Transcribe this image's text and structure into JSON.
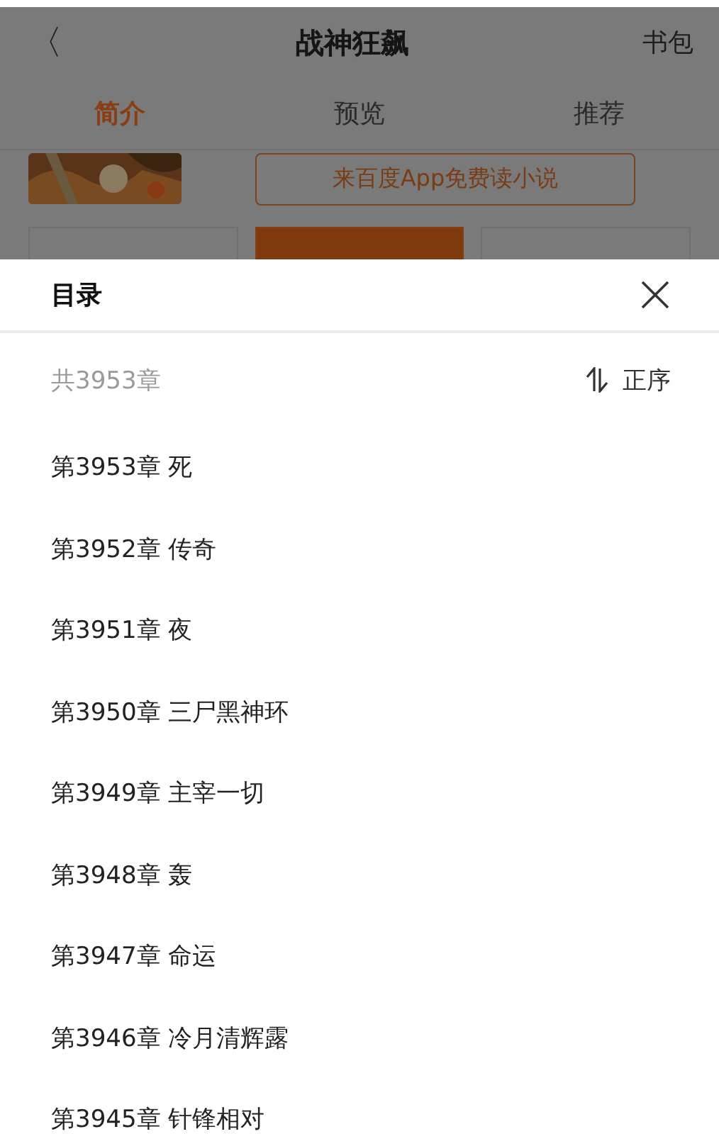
{
  "header": {
    "back": "〈",
    "title": "战神狂飙",
    "action": "书包"
  },
  "tabs": [
    {
      "label": "简介",
      "selected": true
    },
    {
      "label": "预览",
      "selected": false
    },
    {
      "label": "推荐",
      "selected": false
    }
  ],
  "promo": {
    "kind": "picture",
    "tip": "来百度App免费读小说"
  },
  "buttons": [
    {
      "primary": false
    },
    {
      "primary": true
    },
    {
      "primary": false
    }
  ],
  "catalog": {
    "title": "目录",
    "total": "共3953章",
    "order": "正序",
    "chapters": [
      "第3953章 死",
      "第3952章 传奇",
      "第3951章 夜",
      "第3950章 三尸黑神环",
      "第3949章 主宰一切",
      "第3948章 轰",
      "第3947章 命运",
      "第3946章 冷月清辉露",
      "第3945章 针锋相对"
    ]
  }
}
